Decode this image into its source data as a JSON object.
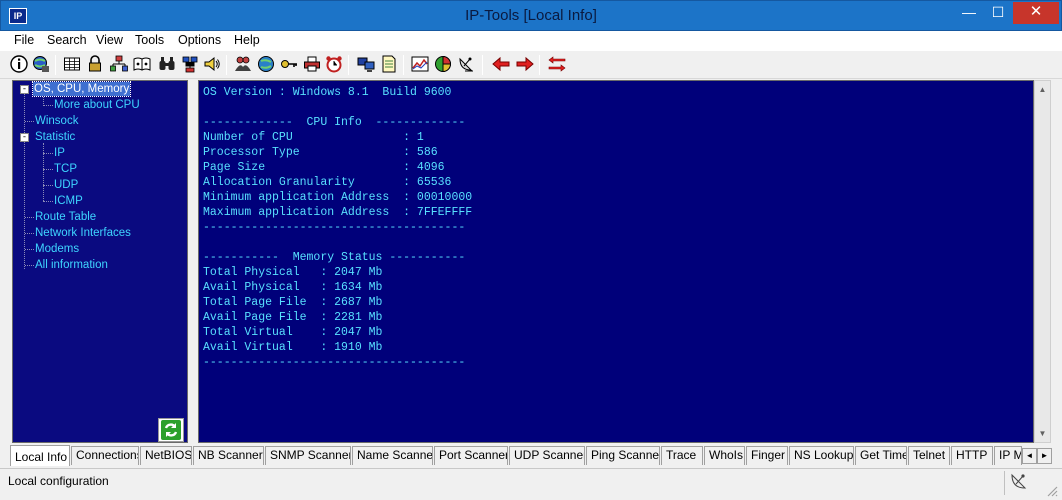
{
  "window": {
    "app_icon_text": "IP",
    "title": "IP-Tools [Local Info]",
    "minimize_glyph": "—",
    "maximize_glyph": "☐",
    "close_glyph": "✕"
  },
  "menu": [
    "File",
    "Search",
    "View",
    "Tools",
    "Options",
    "Help"
  ],
  "toolbar": {
    "buttons": [
      "info-icon",
      "globe-network-icon",
      "table-icon",
      "lock-icon",
      "network-tree-icon",
      "book-icon",
      "binoculars-icon",
      "host-monitor-icon",
      "speaker-icon",
      "users-icon",
      "globe-refresh-icon",
      "key-icon",
      "printer-icon",
      "alarm-clock-icon",
      "computers-icon",
      "document-icon",
      "graph-icon",
      "pie-chart-icon",
      "satellite-dish-icon",
      "arrow-left-icon",
      "arrow-right-icon",
      "split-arrows-icon"
    ]
  },
  "tree": {
    "items": [
      {
        "label": "OS, CPU, Memory",
        "selected": true
      },
      {
        "label": "More about CPU"
      },
      {
        "label": "Winsock"
      },
      {
        "label": "Statistic"
      },
      {
        "label": "IP"
      },
      {
        "label": "TCP"
      },
      {
        "label": "UDP"
      },
      {
        "label": "ICMP"
      },
      {
        "label": "Route Table"
      },
      {
        "label": "Network Interfaces"
      },
      {
        "label": "Modems"
      },
      {
        "label": "All information"
      }
    ],
    "expander_minus": "-"
  },
  "output": {
    "lines": [
      "OS Version : Windows 8.1  Build 9600",
      "",
      "-------------  CPU Info  -------------",
      "Number of CPU                : 1",
      "Processor Type               : 586",
      "Page Size                    : 4096",
      "Allocation Granularity       : 65536",
      "Minimum application Address  : 00010000",
      "Maximum application Address  : 7FFEFFFF",
      "--------------------------------------",
      "",
      "-----------  Memory Status -----------",
      "Total Physical   : 2047 Mb",
      "Avail Physical   : 1634 Mb",
      "Total Page File  : 2687 Mb",
      "Avail Page File  : 2281 Mb",
      "Total Virtual    : 2047 Mb",
      "Avail Virtual    : 1910 Mb",
      "--------------------------------------"
    ]
  },
  "scrollbar": {
    "up": "▲",
    "down": "▼"
  },
  "tabs": {
    "items": [
      "Local Info",
      "Connections",
      "NetBIOS",
      "NB Scanner",
      "SNMP Scanner",
      "Name Scanner",
      "Port Scanner",
      "UDP Scanner",
      "Ping Scanner",
      "Trace",
      "WhoIs",
      "Finger",
      "NS Lookup",
      "Get Time",
      "Telnet",
      "HTTP",
      "IP M"
    ],
    "active_index": 0,
    "scroll_left": "◄",
    "scroll_right": "►"
  },
  "status": {
    "text": "Local configuration"
  }
}
